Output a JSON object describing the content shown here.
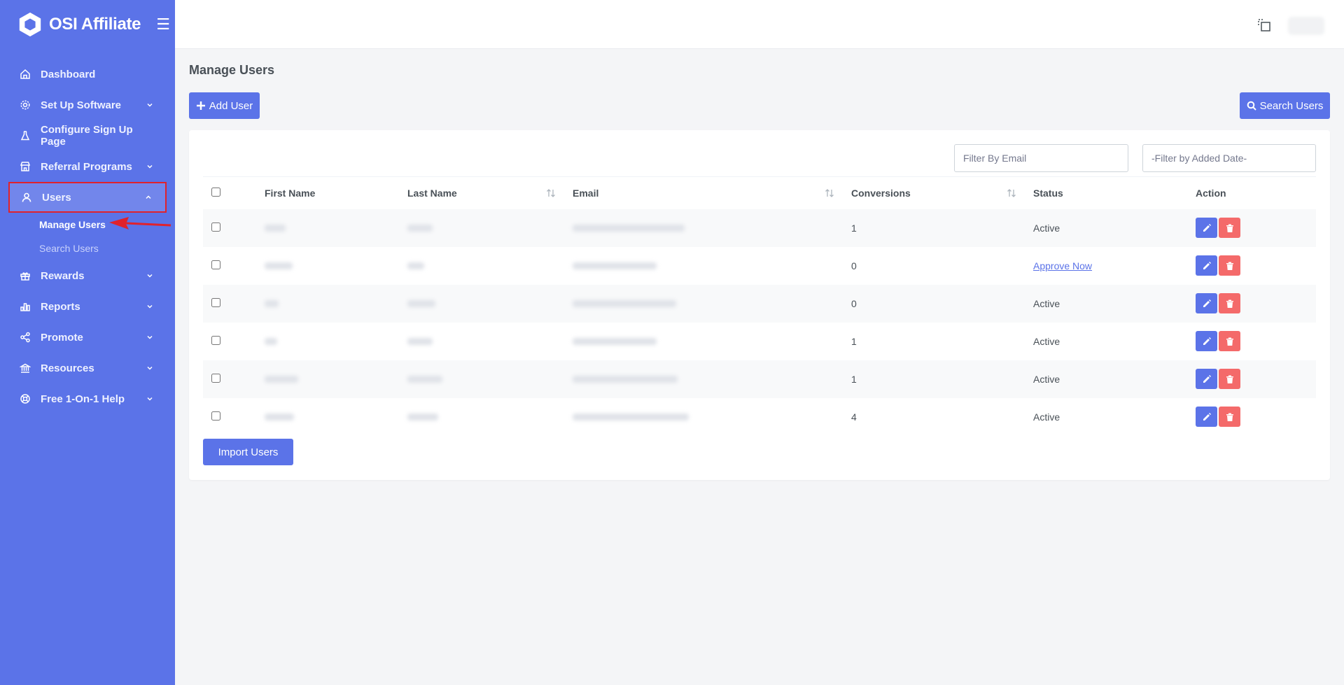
{
  "brand": {
    "name": "OSI Affiliate"
  },
  "sidebar": {
    "items": [
      {
        "label": "Dashboard",
        "icon": "home-icon"
      },
      {
        "label": "Set Up Software",
        "icon": "gear-icon"
      },
      {
        "label": "Configure Sign Up Page",
        "icon": "flask-icon"
      },
      {
        "label": "Referral Programs",
        "icon": "store-icon"
      },
      {
        "label": "Users",
        "icon": "user-icon"
      },
      {
        "label": "Rewards",
        "icon": "gift-icon"
      },
      {
        "label": "Reports",
        "icon": "bar-chart-icon"
      },
      {
        "label": "Promote",
        "icon": "share-icon"
      },
      {
        "label": "Resources",
        "icon": "bank-icon"
      },
      {
        "label": "Free 1-On-1 Help",
        "icon": "lifebuoy-icon"
      }
    ],
    "users_sub": [
      {
        "label": "Manage Users"
      },
      {
        "label": "Search Users"
      }
    ]
  },
  "page": {
    "title": "Manage Users",
    "add_user_label": "Add User",
    "search_users_label": "Search Users",
    "filter_email_placeholder": "Filter By Email",
    "filter_date_placeholder": "-Filter by Added Date-",
    "import_label": "Import Users"
  },
  "table": {
    "headers": [
      "First Name",
      "Last Name",
      "Email",
      "Conversions",
      "Status",
      "Action"
    ],
    "rows": [
      {
        "conversions": "1",
        "status": "Active"
      },
      {
        "conversions": "0",
        "status": "Approve Now"
      },
      {
        "conversions": "0",
        "status": "Active"
      },
      {
        "conversions": "1",
        "status": "Active"
      },
      {
        "conversions": "1",
        "status": "Active"
      },
      {
        "conversions": "4",
        "status": "Active"
      }
    ]
  },
  "colors": {
    "sidebar": "#5b73e8",
    "primary": "#5b73e8",
    "danger": "#f46a6a",
    "highlight": "#e0222c"
  }
}
